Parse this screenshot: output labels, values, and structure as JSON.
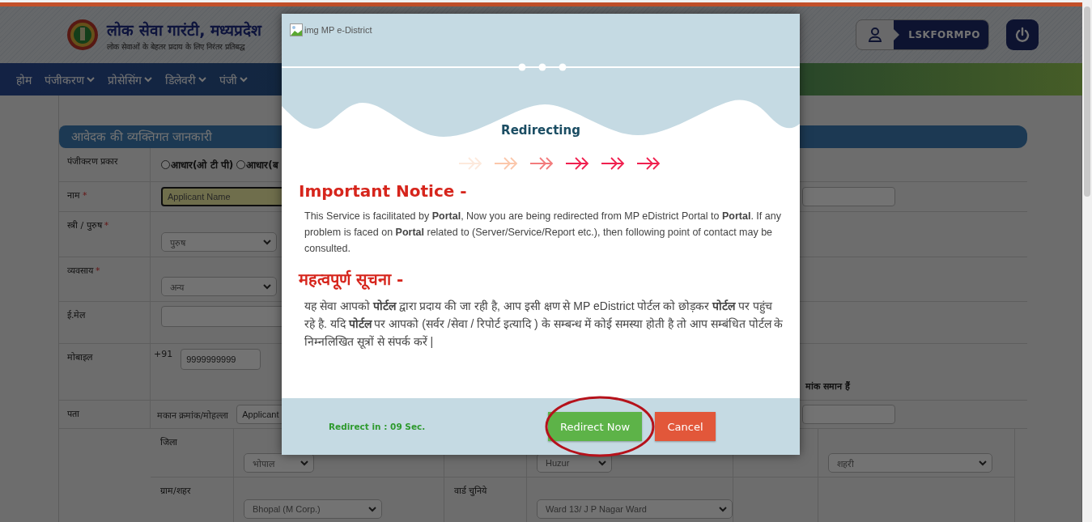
{
  "header": {
    "title": "लोक सेवा गारंटी, मध्यप्रदेश",
    "subtitle": "लोक सेवाओं के बेहतर प्रदाय के लिए निरंतर प्रतिबद्ध",
    "username": "LSKFORMPO"
  },
  "nav": [
    {
      "label": "होम",
      "dropdown": false
    },
    {
      "label": "पंजीकरण",
      "dropdown": true
    },
    {
      "label": "प्रोसेसिंग",
      "dropdown": true
    },
    {
      "label": "डिलेवरी",
      "dropdown": true
    },
    {
      "label": "पंजी",
      "dropdown": true
    }
  ],
  "form": {
    "title": "आवेदक की व्यक्तिगत जानकारी",
    "rows": [
      {
        "label": "पंजीकरण प्रकार",
        "fields": [
          {
            "kind": "radio",
            "label": "आधार(ओ टी पी)",
            "selected": false
          },
          {
            "kind": "radio",
            "label": "आधार(ब",
            "selected": false
          }
        ]
      },
      {
        "label": "नाम",
        "marker": "*",
        "fields": [
          {
            "kind": "input",
            "placeholder": "Applicant Name",
            "highlighted": true
          }
        ],
        "aside": [
          {
            "kind": "input",
            "highlighted": false
          }
        ]
      },
      {
        "label": "स्त्री / पुरुष",
        "marker": "*",
        "fields": [
          {
            "kind": "select",
            "value": "पुरुष"
          }
        ]
      },
      {
        "label": "व्यवसाय",
        "marker": "*",
        "fields": [
          {
            "kind": "select",
            "value": "अन्य"
          }
        ]
      },
      {
        "label": "ई.मेल",
        "fields": [
          {
            "kind": "input",
            "highlighted": false
          }
        ]
      },
      {
        "label": "मोबाइल",
        "fields": [
          {
            "kind": "text",
            "text": "+91"
          },
          {
            "kind": "input",
            "value": "9999999999",
            "highlighted": false
          }
        ],
        "aside": [
          {
            "kind": "note",
            "text": "मांक समान हैं"
          }
        ]
      },
      {
        "label": "पता",
        "fields": [
          {
            "kind": "text",
            "text": "मकान क्रमांक/मोहल्ला"
          },
          {
            "kind": "input",
            "value": "Applicant",
            "highlighted": false
          }
        ],
        "aside": [
          {
            "kind": "input",
            "highlighted": false
          }
        ]
      }
    ],
    "address": [
      [
        {
          "kind": "label",
          "text": "जिला"
        },
        {
          "kind": "select",
          "value": "भोपाल"
        },
        {
          "kind": "blank"
        },
        {
          "kind": "select",
          "value": "Huzur"
        },
        {
          "kind": "blank"
        },
        {
          "kind": "select",
          "value": "शहरी"
        }
      ],
      [
        {
          "kind": "label",
          "text": "ग्राम/शहर"
        },
        {
          "kind": "select",
          "value": "Bhopal (M Corp.)"
        },
        {
          "kind": "label",
          "text": "वार्ड चुनिये"
        },
        {
          "kind": "select",
          "value": "Ward 13/ J P Nagar Ward"
        },
        {
          "kind": "blank"
        },
        {
          "kind": "blank"
        }
      ]
    ]
  },
  "modal": {
    "logo_alt": "img MP e-District",
    "title": "Redirecting",
    "notices": [
      {
        "heading": "Important Notice -",
        "text": "This Service is facilitated by **Portal**, Now you are being redirected from MP eDistrict Portal to **Portal**. If any problem is faced on **Portal** related to (Server/Service/Report etc.), then following point of contact may be consulted.",
        "kind": "en"
      },
      {
        "heading": "महत्वपूर्ण सूचना -",
        "text": "यह सेवा आपको **पोर्टल** द्वारा प्रदाय की जा रही है, आप इसी क्षण से MP eDistrict पोर्टल को छोड़कर **पोर्टल** पर पहुंच रहे है. यदि **पोर्टल** पर आपको (सर्वर /सेवा / रिपोर्ट इत्यादि ) के सम्बन्ध में कोई समस्या होती है तो आप सम्बंधित पोर्टल के निम्नलिखित सूत्रों से संपर्क करें |",
        "kind": "hi"
      }
    ],
    "countdown": "Redirect in : 09 Sec.",
    "buttons": [
      {
        "label": "Redirect Now",
        "kind": "primary",
        "circled": true
      },
      {
        "label": "Cancel",
        "kind": "danger",
        "circled": false
      }
    ]
  }
}
